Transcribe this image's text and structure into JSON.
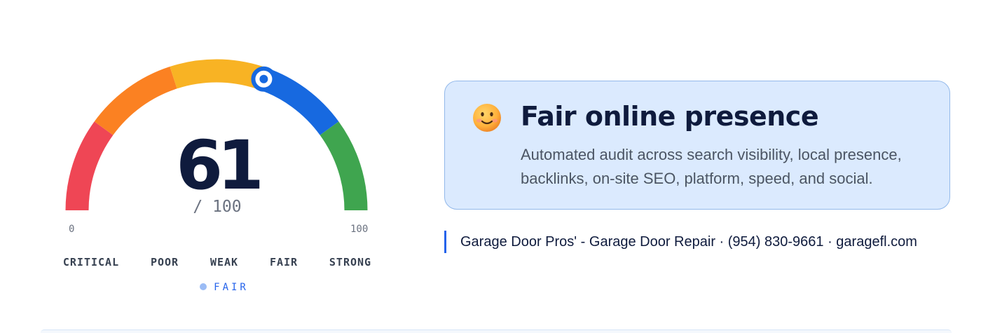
{
  "gauge": {
    "score": "61",
    "max_label": "/ 100",
    "score_fraction": 0.61,
    "min_label": "0",
    "max_value_label": "100",
    "bands": [
      {
        "label": "CRITICAL",
        "color": "#ef4655"
      },
      {
        "label": "POOR",
        "color": "#fb8122"
      },
      {
        "label": "WEAK",
        "color": "#f8b324"
      },
      {
        "label": "FAIR",
        "color": "#1769e0"
      },
      {
        "label": "STRONG",
        "color": "#3fa54f"
      }
    ],
    "current_band": "FAIR",
    "marker_icon": "gauge-needle-marker-icon"
  },
  "card": {
    "emoji_icon": "smiling-face-icon",
    "title": "Fair online presence",
    "description": "Automated audit across search visibility, local presence, backlinks, on-site SEO, platform, speed, and social.",
    "background": "#dbeafe",
    "border": "#93b9ea"
  },
  "business": {
    "text": "Garage Door Pros' - Garage Door Repair · (954) 830-9661 · garagefl.com"
  },
  "colors": {
    "accent": "#2563eb",
    "text_dark": "#0f1b3d",
    "text_muted": "#6b7280"
  }
}
